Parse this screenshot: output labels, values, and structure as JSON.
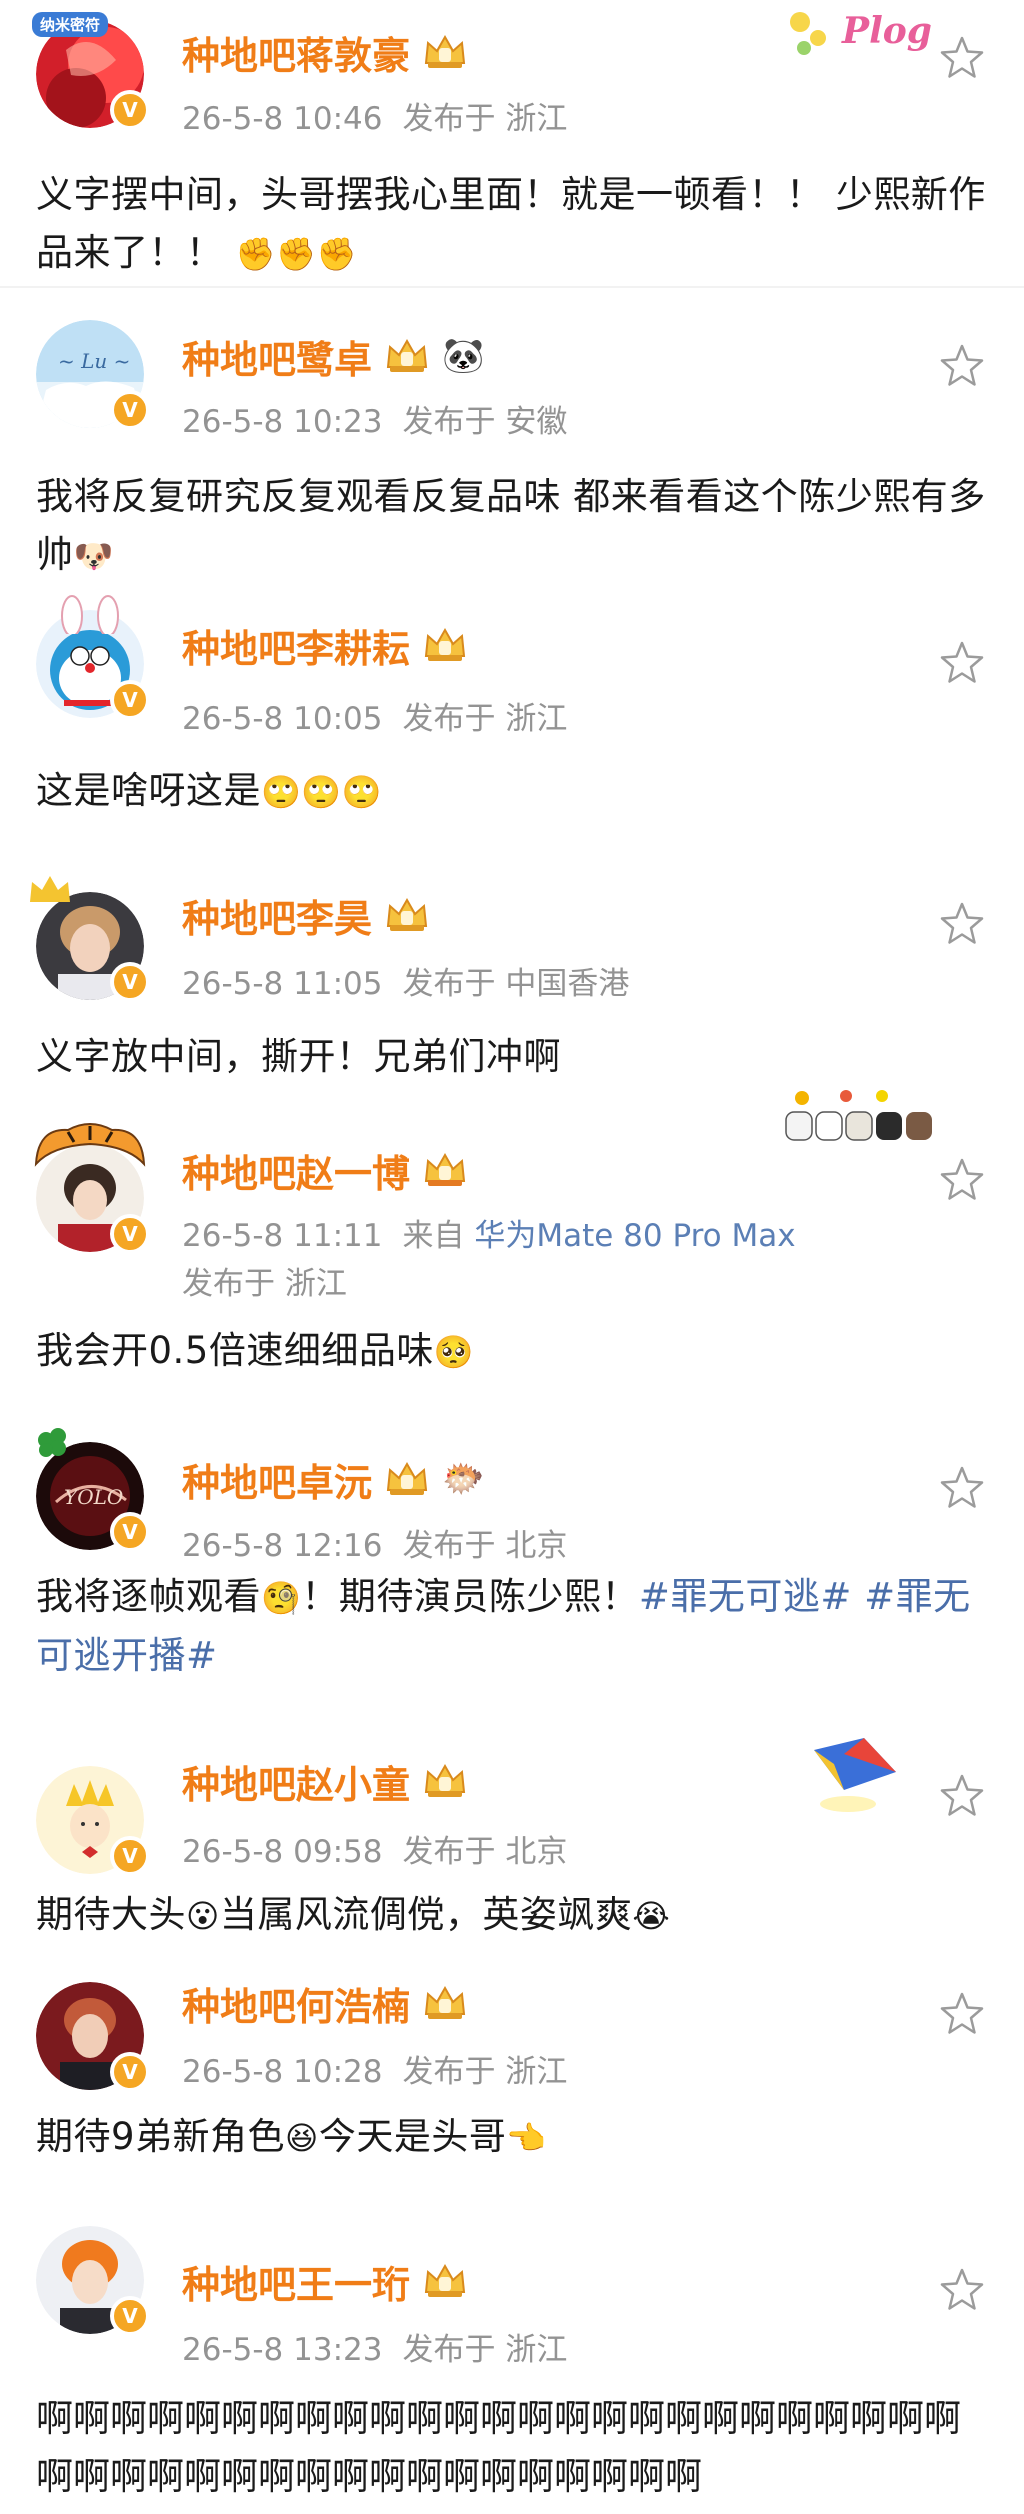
{
  "comments": [
    {
      "username": "种地吧蒋敦豪",
      "time": "26-5-8 10:46",
      "location_label": "发布于",
      "location": "浙江",
      "text": "义字摆中间，头哥摆我心里面！就是一顿看！！ 少熙新作品来了！！",
      "emoji": "✊✊✊",
      "avatar_badge": "纳米密符",
      "sticker_text": "Plog"
    },
    {
      "username": "种地吧鹭卓",
      "extra_icon": "🐼",
      "time": "26-5-8 10:23",
      "location_label": "发布于",
      "location": "安徽",
      "text": "我将反复研究反复观看反复品味 都来看看这个陈少熙有多帅",
      "emoji": "🐶"
    },
    {
      "username": "种地吧李耕耘",
      "time": "26-5-8 10:05",
      "location_label": "发布于",
      "location": "浙江",
      "text": "这是啥呀这是",
      "emoji": "🙄🙄🙄"
    },
    {
      "username": "种地吧李昊",
      "time": "26-5-8 11:05",
      "location_label": "发布于",
      "location": "中国香港",
      "text": "义字放中间，撕开！兄弟们冲啊"
    },
    {
      "username": "种地吧赵一博",
      "time": "26-5-8 11:11",
      "source_label": "来自",
      "device": "华为Mate 80 Pro Max",
      "location_label": "发布于",
      "location": "浙江",
      "text": "我会开0.5倍速细细品味",
      "emoji": "🥺"
    },
    {
      "username": "种地吧卓沅",
      "extra_icon": "🐡",
      "time": "26-5-8 12:16",
      "location_label": "发布于",
      "location": "北京",
      "text_before": "我将逐帧观看",
      "emoji": "🧐",
      "text_after": "！期待演员陈少熙！",
      "hashtag1": "#罪无可逃#",
      "hashtag2": "#罪无可逃开播#"
    },
    {
      "username": "种地吧赵小童",
      "time": "26-5-8 09:58",
      "location_label": "发布于",
      "location": "北京",
      "text_a": "期待大头",
      "emoji_a": "😮",
      "text_b": "当属风流倜傥，英姿飒爽",
      "emoji_b": "😭"
    },
    {
      "username": "种地吧何浩楠",
      "time": "26-5-8 10:28",
      "location_label": "发布于",
      "location": "浙江",
      "text_a": "期待9弟新角色",
      "emoji_a": "😆",
      "text_b": "今天是头哥",
      "emoji_b": "👈"
    },
    {
      "username": "种地吧王一珩",
      "time": "26-5-8 13:23",
      "location_label": "发布于",
      "location": "浙江",
      "text": "啊啊啊啊啊啊啊啊啊啊啊啊啊啊啊啊啊啊啊啊啊啊啊啊啊啊啊啊啊啊啊啊啊啊啊啊啊啊啊啊啊啊啊"
    }
  ],
  "colors": {
    "username": "#f07d17",
    "meta": "#939393",
    "hashtag": "#4a6ea9",
    "verified": "#f5a623"
  },
  "icons": {
    "favorite": "star-outline-icon",
    "member": "crown-icon",
    "verified": "verified-v-badge-icon"
  }
}
